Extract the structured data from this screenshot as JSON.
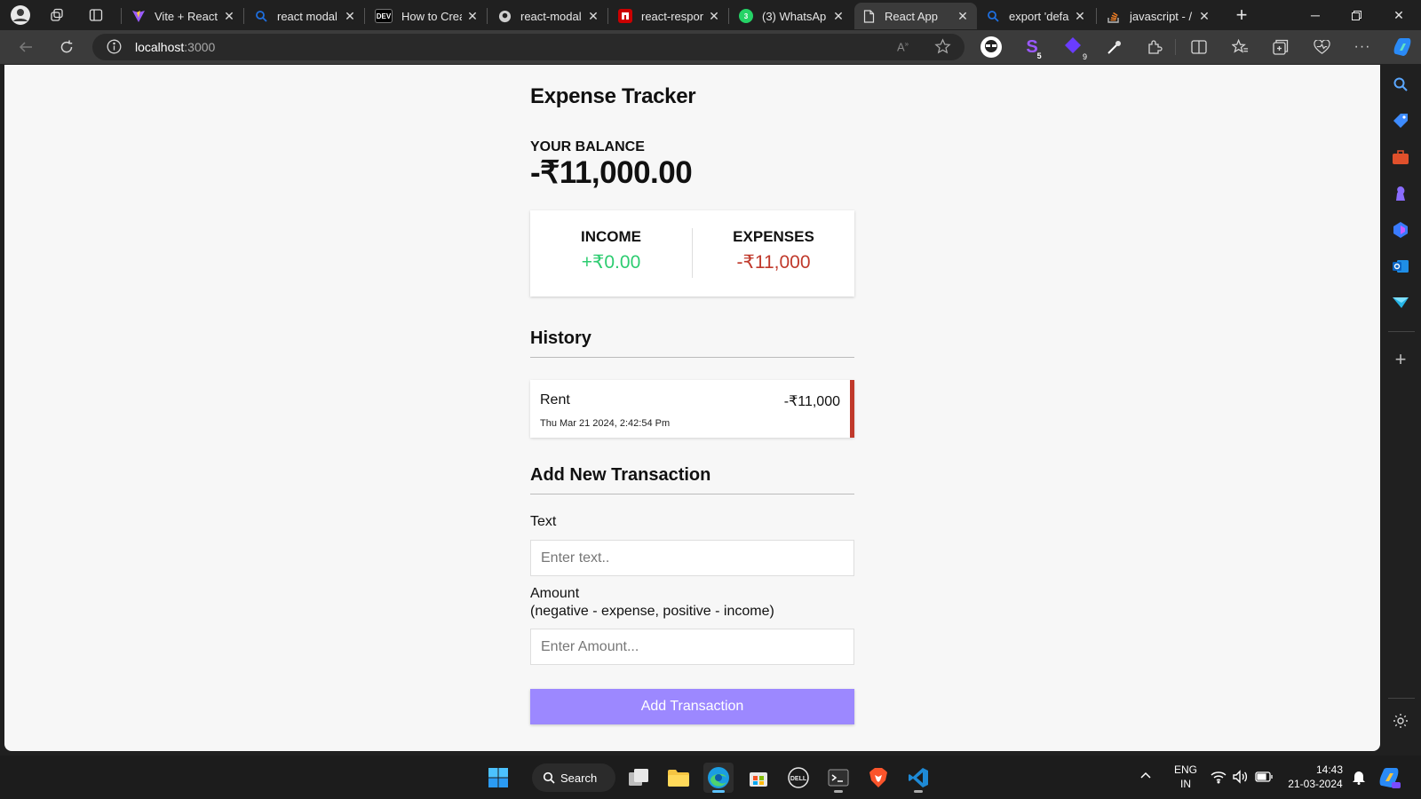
{
  "browser": {
    "tabs": [
      {
        "title": "Vite + React",
        "favicon": "vite",
        "color": "#9a5cff"
      },
      {
        "title": "react modal",
        "favicon": "search",
        "color": "#1e6fe0"
      },
      {
        "title": "How to Crea",
        "favicon": "dev",
        "color": "#000000"
      },
      {
        "title": "react-modal",
        "favicon": "github",
        "color": "#555555"
      },
      {
        "title": "react-respon",
        "favicon": "npm",
        "color": "#cb0000"
      },
      {
        "title": "(3) WhatsAp",
        "favicon": "whatsapp",
        "color": "#25d366"
      },
      {
        "title": "React App",
        "favicon": "page",
        "color": "#ffffff"
      },
      {
        "title": "export 'defa",
        "favicon": "search",
        "color": "#1e6fe0"
      },
      {
        "title": "javascript - /",
        "favicon": "stackoverflow",
        "color": "#f48024"
      }
    ],
    "whatsapp_badge": "3",
    "dev_badge": "DEV",
    "url_host": "localhost",
    "url_port": ":3000",
    "ext_badge_s": "5",
    "ext_badge_diamond": "9"
  },
  "app": {
    "title": "Expense Tracker",
    "balance_label": "YOUR BALANCE",
    "balance_value": "-₹11,000.00",
    "income_label": "INCOME",
    "income_value": "+₹0.00",
    "expense_label": "EXPENSES",
    "expense_value": "-₹11,000",
    "history_title": "History",
    "transactions": [
      {
        "text": "Rent",
        "amount": "-₹11,000",
        "date": "Thu Mar 21 2024, 2:42:54 Pm"
      }
    ],
    "add_title": "Add New Transaction",
    "text_label": "Text",
    "text_placeholder": "Enter text..",
    "amount_label": "Amount",
    "amount_hint": "(negative - expense, positive - income)",
    "amount_placeholder": "Enter Amount...",
    "add_button": "Add Transaction",
    "colors": {
      "income": "#2ecc71",
      "expense": "#c0392b",
      "button": "#9c88ff"
    }
  },
  "taskbar": {
    "search_label": "Search",
    "lang_top": "ENG",
    "lang_bottom": "IN",
    "time": "14:43",
    "date": "21-03-2024"
  }
}
